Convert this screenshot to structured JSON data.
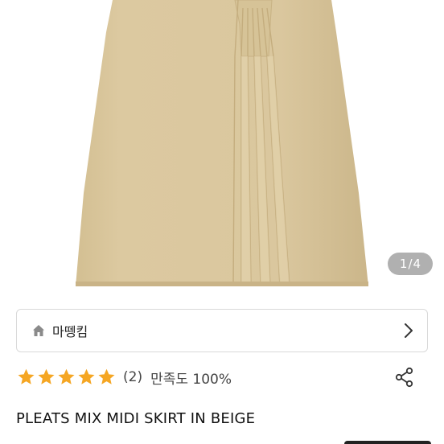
{
  "gallery": {
    "current": "1",
    "separator": "/",
    "total": "4"
  },
  "shop": {
    "name": "마뗑킴",
    "icon": "home-icon",
    "chevron": "chevron-right-icon"
  },
  "rating": {
    "stars": 5,
    "max_stars": 5,
    "star_color": "#f5a623",
    "review_count": "(2)",
    "satisfaction": "만족도 100%"
  },
  "product": {
    "title": "PLEATS MIX MIDI SKIRT IN BEIGE",
    "image_alt_color": "#dcc9a0"
  },
  "share": {
    "icon": "share-icon"
  }
}
